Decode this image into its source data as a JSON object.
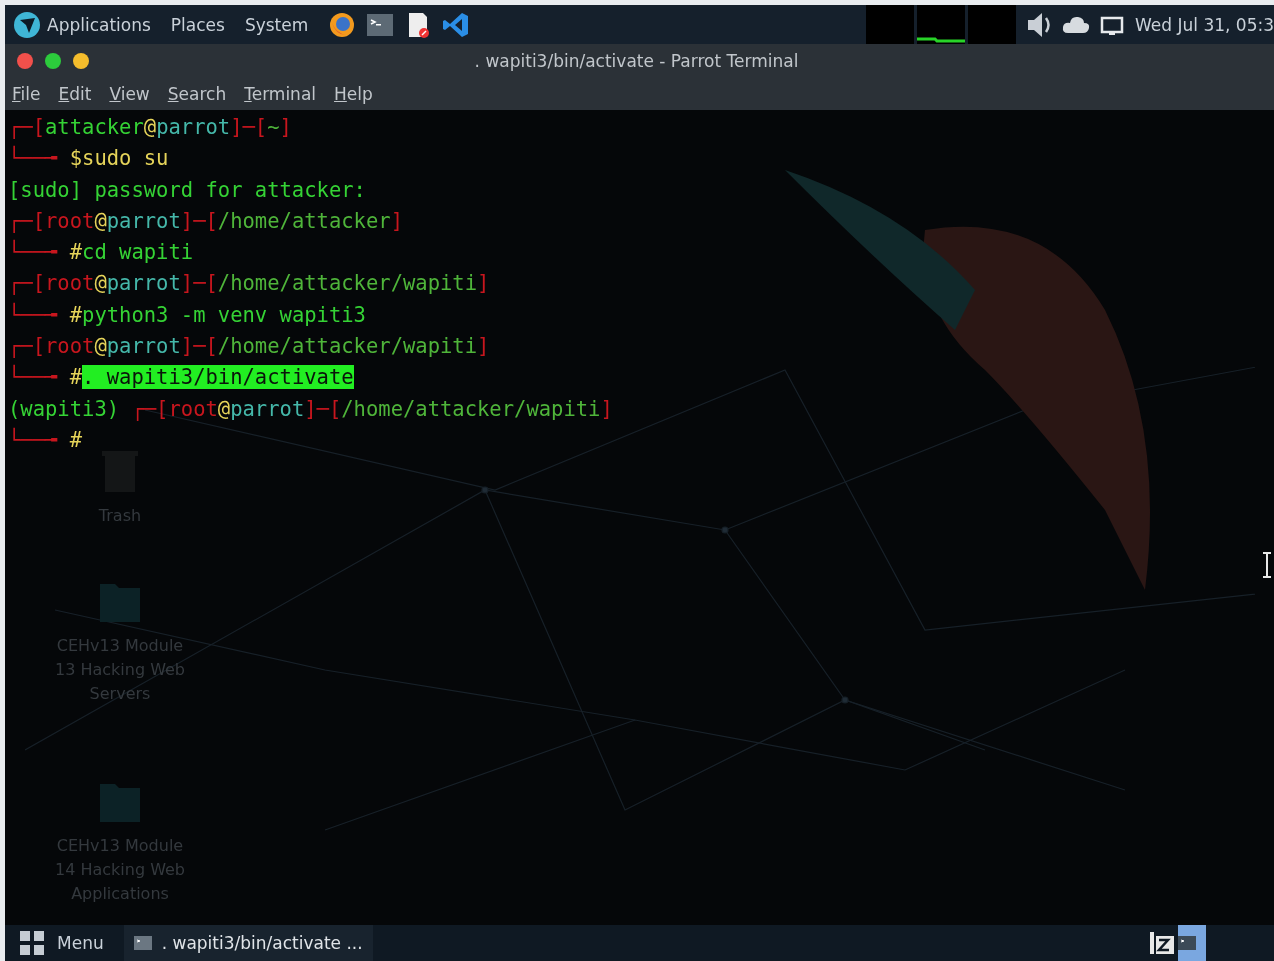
{
  "top_panel": {
    "menus": [
      "Applications",
      "Places",
      "System"
    ],
    "clock": "Wed Jul 31, 05:3"
  },
  "window": {
    "title": ". wapiti3/bin/activate - Parrot Terminal",
    "menu": [
      "File",
      "Edit",
      "View",
      "Search",
      "Terminal",
      "Help"
    ]
  },
  "desktop_icons": [
    {
      "kind": "trash",
      "label": "Trash"
    },
    {
      "kind": "folder",
      "label": "CEHv13 Module 13 Hacking Web Servers"
    },
    {
      "kind": "folder",
      "label": "CEHv13 Module 14 Hacking Web Applications"
    }
  ],
  "terminal_lines": [
    {
      "segments": [
        {
          "text": "┌─[",
          "color": "#c8161e",
          "selected": false
        },
        {
          "text": "attacker",
          "color": "#35d335",
          "selected": false
        },
        {
          "text": "@",
          "color": "#e6d45a",
          "selected": false
        },
        {
          "text": "parrot",
          "color": "#45b8aa",
          "selected": false
        },
        {
          "text": "]─[",
          "color": "#c8161e",
          "selected": false
        },
        {
          "text": "~",
          "color": "#4fb53a",
          "selected": false
        },
        {
          "text": "]",
          "color": "#c8161e",
          "selected": false
        }
      ]
    },
    {
      "segments": [
        {
          "text": "└──╼ ",
          "color": "#c8161e",
          "selected": false
        },
        {
          "text": "$",
          "color": "#e6d45a",
          "selected": false
        },
        {
          "text": "sudo su",
          "color": "#e6d45a",
          "selected": false
        }
      ]
    },
    {
      "segments": [
        {
          "text": "[sudo] password for attacker:",
          "color": "#35d335",
          "selected": false
        }
      ]
    },
    {
      "segments": [
        {
          "text": "┌─[",
          "color": "#c8161e",
          "selected": false
        },
        {
          "text": "root",
          "color": "#c8161e",
          "selected": false
        },
        {
          "text": "@",
          "color": "#e6d45a",
          "selected": false
        },
        {
          "text": "parrot",
          "color": "#45b8aa",
          "selected": false
        },
        {
          "text": "]─[",
          "color": "#c8161e",
          "selected": false
        },
        {
          "text": "/home/attacker",
          "color": "#4fb53a",
          "selected": false
        },
        {
          "text": "]",
          "color": "#c8161e",
          "selected": false
        }
      ]
    },
    {
      "segments": [
        {
          "text": "└──╼ ",
          "color": "#c8161e",
          "selected": false
        },
        {
          "text": "#",
          "color": "#e6d45a",
          "selected": false
        },
        {
          "text": "cd wapiti",
          "color": "#35d335",
          "selected": false
        }
      ]
    },
    {
      "segments": [
        {
          "text": "┌─[",
          "color": "#c8161e",
          "selected": false
        },
        {
          "text": "root",
          "color": "#c8161e",
          "selected": false
        },
        {
          "text": "@",
          "color": "#e6d45a",
          "selected": false
        },
        {
          "text": "parrot",
          "color": "#45b8aa",
          "selected": false
        },
        {
          "text": "]─[",
          "color": "#c8161e",
          "selected": false
        },
        {
          "text": "/home/attacker/wapiti",
          "color": "#4fb53a",
          "selected": false
        },
        {
          "text": "]",
          "color": "#c8161e",
          "selected": false
        }
      ]
    },
    {
      "segments": [
        {
          "text": "└──╼ ",
          "color": "#c8161e",
          "selected": false
        },
        {
          "text": "#",
          "color": "#e6d45a",
          "selected": false
        },
        {
          "text": "python3 -m venv wapiti3",
          "color": "#35d335",
          "selected": false
        }
      ]
    },
    {
      "segments": [
        {
          "text": "┌─[",
          "color": "#c8161e",
          "selected": false
        },
        {
          "text": "root",
          "color": "#c8161e",
          "selected": false
        },
        {
          "text": "@",
          "color": "#e6d45a",
          "selected": false
        },
        {
          "text": "parrot",
          "color": "#45b8aa",
          "selected": false
        },
        {
          "text": "]─[",
          "color": "#c8161e",
          "selected": false
        },
        {
          "text": "/home/attacker/wapiti",
          "color": "#4fb53a",
          "selected": false
        },
        {
          "text": "]",
          "color": "#c8161e",
          "selected": false
        }
      ]
    },
    {
      "segments": [
        {
          "text": "└──╼ ",
          "color": "#c8161e",
          "selected": false
        },
        {
          "text": "#",
          "color": "#e6d45a",
          "selected": false
        },
        {
          "text": ". wapiti3/bin/activate",
          "color": "#22ee22",
          "selected": true
        }
      ]
    },
    {
      "segments": [
        {
          "text": "(wapiti3) ",
          "color": "#35d335",
          "selected": false
        },
        {
          "text": "┌─[",
          "color": "#c8161e",
          "selected": false
        },
        {
          "text": "root",
          "color": "#c8161e",
          "selected": false
        },
        {
          "text": "@",
          "color": "#e6d45a",
          "selected": false
        },
        {
          "text": "parrot",
          "color": "#45b8aa",
          "selected": false
        },
        {
          "text": "]─[",
          "color": "#c8161e",
          "selected": false
        },
        {
          "text": "/home/attacker/wapiti",
          "color": "#4fb53a",
          "selected": false
        },
        {
          "text": "]",
          "color": "#c8161e",
          "selected": false
        }
      ]
    },
    {
      "segments": [
        {
          "text": "└──╼ ",
          "color": "#c8161e",
          "selected": false
        },
        {
          "text": "#",
          "color": "#e6d45a",
          "selected": false
        }
      ]
    }
  ],
  "taskbar": {
    "menu_label": "Menu",
    "tasks": [
      {
        "label": ". wapiti3/bin/activate ...",
        "selected": false
      }
    ]
  }
}
